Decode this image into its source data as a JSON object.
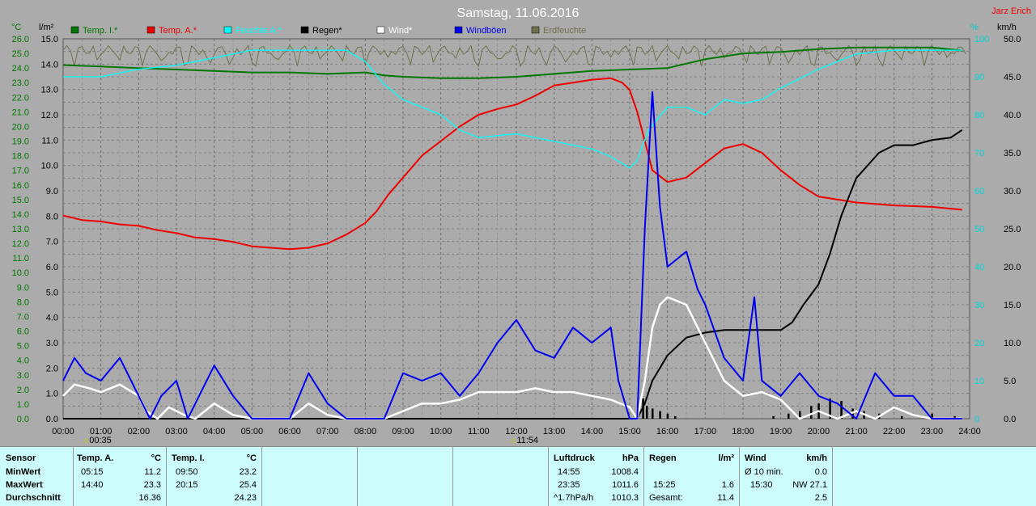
{
  "title": "Samstag, 11.06.2016",
  "author": "Jarz Erich",
  "axes": {
    "left_unit_1": "°C",
    "left_unit_2": "l/m²",
    "right_unit_1": "%",
    "right_unit_2": "km/h",
    "left1_ticks": [
      "0.0",
      "1.0",
      "2.0",
      "3.0",
      "4.0",
      "5.0",
      "6.0",
      "7.0",
      "8.0",
      "9.0",
      "10.0",
      "11.0",
      "12.0",
      "13.0",
      "14.0",
      "15.0",
      "16.0",
      "17.0",
      "18.0",
      "19.0",
      "20.0",
      "21.0",
      "22.0",
      "23.0",
      "24.0",
      "25.0",
      "26.0"
    ],
    "left2_ticks": [
      "0.0",
      "1.0",
      "2.0",
      "3.0",
      "4.0",
      "5.0",
      "6.0",
      "7.0",
      "8.0",
      "9.0",
      "10.0",
      "11.0",
      "12.0",
      "13.0",
      "14.0",
      "15.0"
    ],
    "right1_ticks": [
      "0",
      "10",
      "20",
      "30",
      "40",
      "50",
      "60",
      "70",
      "80",
      "90",
      "100"
    ],
    "right2_ticks": [
      "0.0",
      "5.0",
      "10.0",
      "15.0",
      "20.0",
      "25.0",
      "30.0",
      "35.0",
      "40.0",
      "45.0",
      "50.0"
    ],
    "x_ticks": [
      "00:00",
      "01:00",
      "02:00",
      "03:00",
      "04:00",
      "05:00",
      "06:00",
      "07:00",
      "08:00",
      "09:00",
      "10:00",
      "11:00",
      "12:00",
      "13:00",
      "14:00",
      "15:00",
      "16:00",
      "17:00",
      "18:00",
      "19:00",
      "20:00",
      "21:00",
      "22:00",
      "23:00",
      "24:00"
    ],
    "sun_markers": [
      "00:35",
      "11:54"
    ]
  },
  "legend": [
    {
      "label": "Temp. I.*",
      "color": "#007700"
    },
    {
      "label": "Temp. A.*",
      "color": "#ee0000"
    },
    {
      "label": "Feuchte A.*",
      "color": "#00ffff"
    },
    {
      "label": "Regen*",
      "color": "#000000"
    },
    {
      "label": "Wind*",
      "color": "#ffffff"
    },
    {
      "label": "Windböen",
      "color": "#0000ee"
    },
    {
      "label": "Erdfeuchte",
      "color": "#707050"
    }
  ],
  "chart_data": {
    "type": "line",
    "x_unit": "hour of day",
    "xlim": [
      0,
      24
    ],
    "series": [
      {
        "name": "Temp. I.*",
        "axis": "°C",
        "ylim": [
          0,
          26
        ],
        "color": "#007700",
        "points": [
          [
            0,
            24.2
          ],
          [
            1,
            24.1
          ],
          [
            2,
            24.0
          ],
          [
            3,
            23.9
          ],
          [
            4,
            23.8
          ],
          [
            5,
            23.7
          ],
          [
            6,
            23.7
          ],
          [
            7,
            23.6
          ],
          [
            8,
            23.7
          ],
          [
            8.5,
            23.5
          ],
          [
            9,
            23.4
          ],
          [
            10,
            23.3
          ],
          [
            11,
            23.3
          ],
          [
            12,
            23.4
          ],
          [
            13,
            23.6
          ],
          [
            14,
            23.8
          ],
          [
            15,
            23.9
          ],
          [
            16,
            24.0
          ],
          [
            16.5,
            24.3
          ],
          [
            17,
            24.6
          ],
          [
            18,
            25.0
          ],
          [
            19,
            25.1
          ],
          [
            20,
            25.3
          ],
          [
            21,
            25.4
          ],
          [
            22,
            25.4
          ],
          [
            23,
            25.4
          ],
          [
            23.8,
            25.2
          ]
        ]
      },
      {
        "name": "Temp. A.*",
        "axis": "°C",
        "ylim": [
          0,
          26
        ],
        "color": "#ee0000",
        "points": [
          [
            0,
            13.9
          ],
          [
            0.5,
            13.6
          ],
          [
            1,
            13.5
          ],
          [
            1.5,
            13.3
          ],
          [
            2,
            13.2
          ],
          [
            2.5,
            12.9
          ],
          [
            3,
            12.7
          ],
          [
            3.5,
            12.4
          ],
          [
            4,
            12.3
          ],
          [
            4.5,
            12.1
          ],
          [
            5,
            11.8
          ],
          [
            5.5,
            11.7
          ],
          [
            6,
            11.6
          ],
          [
            6.5,
            11.7
          ],
          [
            7,
            12.0
          ],
          [
            7.5,
            12.6
          ],
          [
            8,
            13.4
          ],
          [
            8.3,
            14.2
          ],
          [
            8.6,
            15.3
          ],
          [
            9,
            16.5
          ],
          [
            9.5,
            18.0
          ],
          [
            10,
            19.0
          ],
          [
            10.5,
            20.0
          ],
          [
            11,
            20.8
          ],
          [
            11.5,
            21.2
          ],
          [
            12,
            21.5
          ],
          [
            12.5,
            22.1
          ],
          [
            13,
            22.8
          ],
          [
            13.5,
            23.0
          ],
          [
            14,
            23.2
          ],
          [
            14.5,
            23.3
          ],
          [
            14.8,
            23.0
          ],
          [
            15,
            22.5
          ],
          [
            15.2,
            21.0
          ],
          [
            15.4,
            19.0
          ],
          [
            15.6,
            17.0
          ],
          [
            16,
            16.2
          ],
          [
            16.5,
            16.5
          ],
          [
            17,
            17.5
          ],
          [
            17.5,
            18.5
          ],
          [
            18,
            18.8
          ],
          [
            18.5,
            18.2
          ],
          [
            19,
            17.0
          ],
          [
            19.5,
            16.0
          ],
          [
            20,
            15.2
          ],
          [
            21,
            14.8
          ],
          [
            22,
            14.6
          ],
          [
            23,
            14.5
          ],
          [
            23.8,
            14.3
          ]
        ]
      },
      {
        "name": "Feuchte A.*",
        "axis": "%",
        "ylim": [
          0,
          100
        ],
        "color": "#00ffff",
        "points": [
          [
            0,
            90
          ],
          [
            1,
            90
          ],
          [
            2,
            92
          ],
          [
            3,
            93
          ],
          [
            4,
            95
          ],
          [
            5,
            97
          ],
          [
            6,
            97
          ],
          [
            7,
            97
          ],
          [
            7.5,
            97
          ],
          [
            8,
            94
          ],
          [
            8.5,
            88
          ],
          [
            9,
            84
          ],
          [
            10,
            80
          ],
          [
            10.5,
            76
          ],
          [
            11,
            74
          ],
          [
            12,
            75
          ],
          [
            12.5,
            74
          ],
          [
            13,
            73
          ],
          [
            13.5,
            72
          ],
          [
            14,
            71
          ],
          [
            14.5,
            69
          ],
          [
            15,
            66
          ],
          [
            15.2,
            68
          ],
          [
            15.5,
            76
          ],
          [
            16,
            82
          ],
          [
            16.5,
            82
          ],
          [
            17,
            80
          ],
          [
            17.5,
            84
          ],
          [
            18,
            83
          ],
          [
            18.5,
            84
          ],
          [
            19,
            87
          ],
          [
            20,
            92
          ],
          [
            21,
            96
          ],
          [
            22,
            97
          ],
          [
            23,
            97
          ],
          [
            23.8,
            97
          ]
        ]
      },
      {
        "name": "Regen*",
        "axis": "l/m²",
        "ylim": [
          0,
          15
        ],
        "color": "#000000",
        "points": [
          [
            0,
            0
          ],
          [
            15.2,
            0
          ],
          [
            15.4,
            0.6
          ],
          [
            15.6,
            1.5
          ],
          [
            16,
            2.5
          ],
          [
            16.5,
            3.2
          ],
          [
            17,
            3.4
          ],
          [
            17.5,
            3.5
          ],
          [
            18,
            3.5
          ],
          [
            18.5,
            3.5
          ],
          [
            19,
            3.5
          ],
          [
            19.3,
            3.8
          ],
          [
            19.6,
            4.5
          ],
          [
            20,
            5.3
          ],
          [
            20.3,
            6.5
          ],
          [
            20.6,
            8.0
          ],
          [
            21,
            9.5
          ],
          [
            21.3,
            10.0
          ],
          [
            21.6,
            10.5
          ],
          [
            22,
            10.8
          ],
          [
            22.5,
            10.8
          ],
          [
            23,
            11.0
          ],
          [
            23.5,
            11.1
          ],
          [
            23.8,
            11.4
          ]
        ]
      },
      {
        "name": "Wind*",
        "axis": "km/h",
        "ylim": [
          0,
          50
        ],
        "color": "#ffffff",
        "points": [
          [
            0,
            3.0
          ],
          [
            0.3,
            4.5
          ],
          [
            0.7,
            4.0
          ],
          [
            1,
            3.5
          ],
          [
            1.5,
            4.5
          ],
          [
            2,
            3.0
          ],
          [
            2.2,
            1.0
          ],
          [
            2.5,
            0
          ],
          [
            2.8,
            1.5
          ],
          [
            3.2,
            0.5
          ],
          [
            3.5,
            0
          ],
          [
            4,
            2.0
          ],
          [
            4.5,
            0.5
          ],
          [
            5,
            0
          ],
          [
            6,
            0
          ],
          [
            6.5,
            2.0
          ],
          [
            7,
            0.5
          ],
          [
            7.5,
            0
          ],
          [
            8.5,
            0
          ],
          [
            9,
            1.0
          ],
          [
            9.5,
            2.0
          ],
          [
            10,
            2.0
          ],
          [
            10.5,
            2.5
          ],
          [
            11,
            3.5
          ],
          [
            11.5,
            3.5
          ],
          [
            12,
            3.5
          ],
          [
            12.5,
            4.0
          ],
          [
            13,
            3.5
          ],
          [
            13.5,
            3.5
          ],
          [
            14,
            3.0
          ],
          [
            14.5,
            2.5
          ],
          [
            15,
            1.5
          ],
          [
            15.2,
            0
          ],
          [
            15.4,
            5.0
          ],
          [
            15.6,
            12.0
          ],
          [
            15.8,
            15.0
          ],
          [
            16,
            16.0
          ],
          [
            16.5,
            15.0
          ],
          [
            17,
            10.0
          ],
          [
            17.5,
            5.0
          ],
          [
            18,
            3.0
          ],
          [
            18.5,
            3.5
          ],
          [
            19,
            2.5
          ],
          [
            19.5,
            0
          ],
          [
            20,
            1.0
          ],
          [
            20.5,
            0
          ],
          [
            21,
            1.0
          ],
          [
            21.5,
            0
          ],
          [
            22,
            1.5
          ],
          [
            22.5,
            0.5
          ],
          [
            23,
            0
          ],
          [
            23.8,
            0
          ]
        ]
      },
      {
        "name": "Windböen",
        "axis": "km/h",
        "ylim": [
          0,
          50
        ],
        "color": "#0000ee",
        "points": [
          [
            0,
            5
          ],
          [
            0.3,
            8
          ],
          [
            0.6,
            6
          ],
          [
            1,
            5
          ],
          [
            1.5,
            8
          ],
          [
            1.8,
            5
          ],
          [
            2,
            3
          ],
          [
            2.3,
            0
          ],
          [
            2.6,
            3
          ],
          [
            3,
            5
          ],
          [
            3.3,
            0
          ],
          [
            4,
            7
          ],
          [
            4.5,
            3
          ],
          [
            5,
            0
          ],
          [
            6,
            0
          ],
          [
            6.5,
            6
          ],
          [
            7,
            2
          ],
          [
            7.5,
            0
          ],
          [
            8.5,
            0
          ],
          [
            9,
            6
          ],
          [
            9.5,
            5
          ],
          [
            10,
            6
          ],
          [
            10.5,
            3
          ],
          [
            11,
            6
          ],
          [
            11.5,
            10
          ],
          [
            12,
            13
          ],
          [
            12.5,
            9
          ],
          [
            13,
            8
          ],
          [
            13.5,
            12
          ],
          [
            14,
            10
          ],
          [
            14.5,
            12
          ],
          [
            14.7,
            5
          ],
          [
            15,
            0
          ],
          [
            15.2,
            0
          ],
          [
            15.4,
            25
          ],
          [
            15.6,
            43
          ],
          [
            15.8,
            28
          ],
          [
            16,
            20
          ],
          [
            16.5,
            22
          ],
          [
            16.8,
            17
          ],
          [
            17,
            15
          ],
          [
            17.5,
            8
          ],
          [
            18,
            5
          ],
          [
            18.3,
            16
          ],
          [
            18.5,
            5
          ],
          [
            19,
            3
          ],
          [
            19.5,
            6
          ],
          [
            20,
            3
          ],
          [
            20.5,
            2
          ],
          [
            21,
            0
          ],
          [
            21.5,
            6
          ],
          [
            22,
            3
          ],
          [
            22.5,
            3
          ],
          [
            23,
            0
          ],
          [
            23.8,
            0
          ]
        ]
      }
    ],
    "rain_bars_l_per_m2": [
      [
        15.35,
        0.8
      ],
      [
        15.45,
        0.5
      ],
      [
        15.6,
        0.4
      ],
      [
        15.8,
        0.3
      ],
      [
        16,
        0.2
      ],
      [
        16.2,
        0.1
      ],
      [
        18.8,
        0.1
      ],
      [
        19.2,
        0.2
      ],
      [
        19.5,
        0.3
      ],
      [
        19.8,
        0.5
      ],
      [
        20,
        0.6
      ],
      [
        20.3,
        0.8
      ],
      [
        20.6,
        0.7
      ],
      [
        20.9,
        0.4
      ],
      [
        21.2,
        0.3
      ],
      [
        21.6,
        0.2
      ],
      [
        22.2,
        0.1
      ],
      [
        23,
        0.2
      ],
      [
        23.6,
        0.1
      ]
    ]
  },
  "stats": {
    "sensor": {
      "header": "Sensor",
      "rows": [
        "MinWert",
        "MaxWert",
        "Durchschnitt"
      ]
    },
    "temp_a": {
      "header": "Temp. A.",
      "unit": "°C",
      "rows": [
        [
          "05:15",
          "11.2"
        ],
        [
          "14:40",
          "23.3"
        ],
        [
          "",
          "16.36"
        ]
      ]
    },
    "temp_i": {
      "header": "Temp. I.",
      "unit": "°C",
      "rows": [
        [
          "09:50",
          "23.2"
        ],
        [
          "20:15",
          "25.4"
        ],
        [
          "",
          "24.23"
        ]
      ]
    },
    "luftdruck": {
      "header": "Luftdruck",
      "unit": "hPa",
      "rows": [
        [
          "14:55",
          "1008.4"
        ],
        [
          "23:35",
          "1011.6"
        ],
        [
          "^1.7hPa/h",
          "1010.3"
        ]
      ]
    },
    "regen": {
      "header": "Regen",
      "unit": "l/m²",
      "rows": [
        [
          "",
          ""
        ],
        [
          "15:25",
          "1.6"
        ],
        [
          "Gesamt:",
          "11.4"
        ]
      ]
    },
    "wind": {
      "header": "Wind",
      "unit": "km/h",
      "rows": [
        [
          "Ø 10 min.",
          "0.0"
        ],
        [
          "15:30",
          "NW 27.1"
        ],
        [
          "",
          "2.5"
        ]
      ]
    }
  }
}
